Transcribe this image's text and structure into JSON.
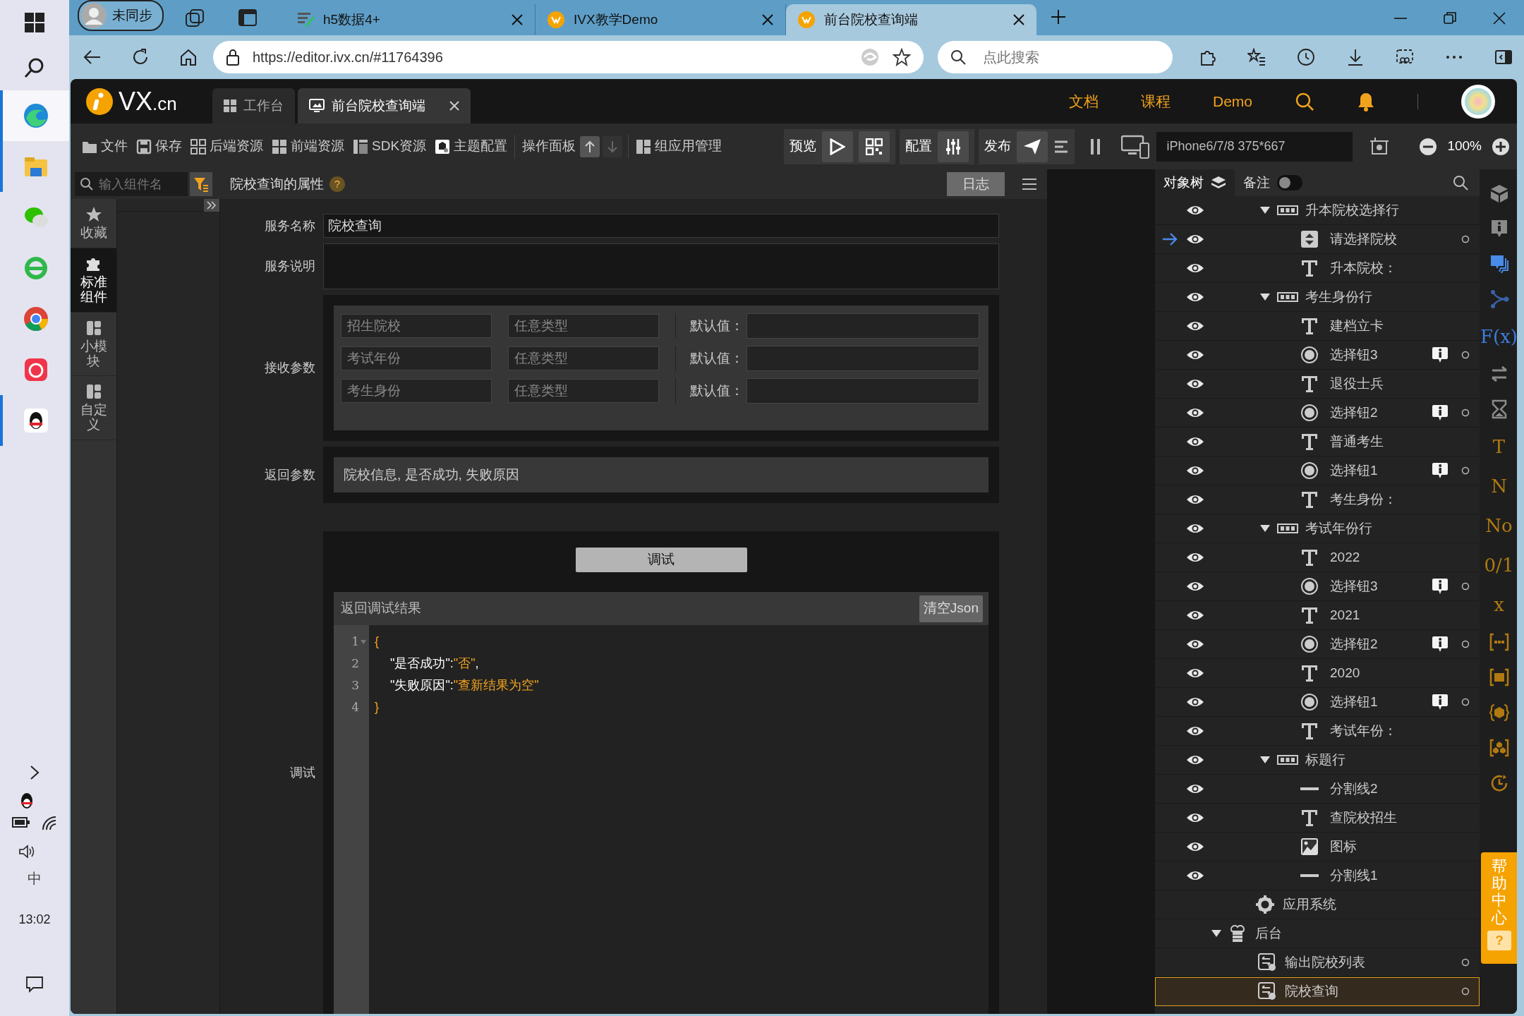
{
  "taskbar": {
    "apps": [
      {
        "running": true,
        "active": true
      },
      {
        "running": true,
        "active": false
      },
      {
        "running": false,
        "active": false
      },
      {
        "running": false,
        "active": false
      },
      {
        "running": false,
        "active": false
      },
      {
        "running": false,
        "active": false
      },
      {
        "running": true,
        "active": false
      }
    ],
    "ime": "中",
    "time": "13:02"
  },
  "browser": {
    "profile": "未同步",
    "tabs": [
      {
        "title": "h5数据4+",
        "selected": false
      },
      {
        "title": "IVX教学Demo",
        "selected": false
      },
      {
        "title": "前台院校查询端",
        "selected": true
      }
    ],
    "url": "https://editor.ivx.cn/#11764396",
    "search_placeholder": "点此搜索"
  },
  "app": {
    "logo": {
      "name": "VX",
      "domain": ".cn"
    },
    "editor_tabs": [
      {
        "label": "工作台",
        "selected": false
      },
      {
        "label": "前台院校查询端",
        "selected": true
      }
    ],
    "header_links": [
      "文档",
      "课程",
      "Demo"
    ],
    "toolbar": {
      "items": [
        "文件",
        "保存",
        "后端资源",
        "前端资源",
        "SDK资源",
        "主题配置"
      ],
      "panel": "操作面板",
      "manage": "组应用管理",
      "preview": "预览",
      "config": "配置",
      "publish": "发布",
      "device": "iPhone6/7/8 375*667",
      "zoom": "100%"
    },
    "component_search": {
      "placeholder": "输入组件名"
    },
    "rail": [
      {
        "label": "收藏",
        "selected": false
      },
      {
        "label": "标准组件",
        "selected": true
      },
      {
        "label": "小模块",
        "selected": false
      },
      {
        "label": "自定义",
        "selected": false
      }
    ],
    "properties": {
      "title": "院校查询的属性",
      "help": "?",
      "log_button": "日志",
      "service_name": {
        "label": "服务名称",
        "value": "院校查询"
      },
      "service_desc": {
        "label": "服务说明"
      },
      "receive": {
        "label": "接收参数",
        "params": [
          {
            "name": "招生院校",
            "type": "任意类型",
            "default_label": "默认值："
          },
          {
            "name": "考试年份",
            "type": "任意类型",
            "default_label": "默认值："
          },
          {
            "name": "考生身份",
            "type": "任意类型",
            "default_label": "默认值："
          }
        ]
      },
      "returns": {
        "label": "返回参数",
        "value": "院校信息, 是否成功, 失败原因"
      },
      "debug": {
        "label": "调试",
        "button": "调试",
        "result_title": "返回调试结果",
        "clear_button": "清空Json",
        "code": [
          {
            "num": "1",
            "fold": true,
            "tokens": [
              {
                "kind": "brace",
                "text": "{"
              }
            ]
          },
          {
            "num": "2",
            "fold": false,
            "tokens": [
              {
                "kind": "key",
                "text": "\"是否成功\""
              },
              {
                "kind": "punct",
                "text": ":"
              },
              {
                "kind": "string",
                "text": "\"否\""
              },
              {
                "kind": "punct",
                "text": ","
              }
            ]
          },
          {
            "num": "3",
            "fold": false,
            "tokens": [
              {
                "kind": "key",
                "text": "\"失败原因\""
              },
              {
                "kind": "punct",
                "text": ":"
              },
              {
                "kind": "string",
                "text": "\"查新结果为空\""
              }
            ]
          },
          {
            "num": "4",
            "fold": false,
            "tokens": [
              {
                "kind": "brace",
                "text": "}"
              }
            ]
          }
        ]
      }
    },
    "tree": {
      "tab": "对象树",
      "notes": {
        "label": "备注",
        "on": false
      },
      "rows": [
        {
          "label": "升本院校选择行",
          "visible": true,
          "expanded": true,
          "children": [
            {
              "label": "请选择院校",
              "kind": "select",
              "visible": true,
              "pointer": true,
              "tip": false,
              "ring": true
            },
            {
              "label": "升本院校：",
              "kind": "text",
              "visible": true,
              "pointer": false,
              "tip": false,
              "ring": false
            }
          ]
        },
        {
          "label": "考生身份行",
          "visible": true,
          "expanded": true,
          "children": [
            {
              "label": "建档立卡",
              "kind": "text",
              "visible": true,
              "pointer": false,
              "tip": false,
              "ring": false
            },
            {
              "label": "选择钮3",
              "kind": "radio",
              "visible": true,
              "pointer": false,
              "tip": true,
              "ring": true
            },
            {
              "label": "退役士兵",
              "kind": "text",
              "visible": true,
              "pointer": false,
              "tip": false,
              "ring": false
            },
            {
              "label": "选择钮2",
              "kind": "radio",
              "visible": true,
              "pointer": false,
              "tip": true,
              "ring": true
            },
            {
              "label": "普通考生",
              "kind": "text",
              "visible": true,
              "pointer": false,
              "tip": false,
              "ring": false
            },
            {
              "label": "选择钮1",
              "kind": "radio",
              "visible": true,
              "pointer": false,
              "tip": true,
              "ring": true
            },
            {
              "label": "考生身份：",
              "kind": "text",
              "visible": true,
              "pointer": false,
              "tip": false,
              "ring": false
            }
          ]
        },
        {
          "label": "考试年份行",
          "visible": true,
          "expanded": true,
          "children": [
            {
              "label": "2022",
              "kind": "text",
              "visible": true,
              "pointer": false,
              "tip": false,
              "ring": false
            },
            {
              "label": "选择钮3",
              "kind": "radio",
              "visible": true,
              "pointer": false,
              "tip": true,
              "ring": true
            },
            {
              "label": "2021",
              "kind": "text",
              "visible": true,
              "pointer": false,
              "tip": false,
              "ring": false
            },
            {
              "label": "选择钮2",
              "kind": "radio",
              "visible": true,
              "pointer": false,
              "tip": true,
              "ring": true
            },
            {
              "label": "2020",
              "kind": "text",
              "visible": true,
              "pointer": false,
              "tip": false,
              "ring": false
            },
            {
              "label": "选择钮1",
              "kind": "radio",
              "visible": true,
              "pointer": false,
              "tip": true,
              "ring": true
            },
            {
              "label": "考试年份：",
              "kind": "text",
              "visible": true,
              "pointer": false,
              "tip": false,
              "ring": false
            }
          ]
        },
        {
          "label": "标题行",
          "visible": true,
          "expanded": true,
          "children": [
            {
              "label": "分割线2",
              "kind": "line",
              "visible": true,
              "pointer": false,
              "tip": false,
              "ring": false
            },
            {
              "label": "查院校招生",
              "kind": "text",
              "visible": true,
              "pointer": false,
              "tip": false,
              "ring": false
            },
            {
              "label": "图标",
              "kind": "image",
              "visible": true,
              "pointer": false,
              "tip": false,
              "ring": false
            },
            {
              "label": "分割线1",
              "kind": "line",
              "visible": true,
              "pointer": false,
              "tip": false,
              "ring": false
            }
          ]
        }
      ],
      "app_system": "应用系统",
      "backend": {
        "label": "后台",
        "expanded": true,
        "children": [
          {
            "label": "输出院校列表",
            "selected": false,
            "ring": true
          },
          {
            "label": "院校查询",
            "selected": true,
            "ring": true
          }
        ]
      }
    },
    "tool_rail": [
      {
        "kind": "icon",
        "color": "#8a8a8a"
      },
      {
        "kind": "icon",
        "color": "#8a8a8a"
      },
      {
        "kind": "icon",
        "color": "#4a8ae8"
      },
      {
        "kind": "icon",
        "color": "#3a62a8"
      },
      {
        "kind": "glyph",
        "text": "F(x)",
        "color": "#3d7de0"
      },
      {
        "kind": "icon",
        "color": "#8a8a8a"
      },
      {
        "kind": "icon",
        "color": "#8a8a8a"
      },
      {
        "kind": "glyph",
        "text": "T",
        "color": "#b07a10"
      },
      {
        "kind": "glyph",
        "text": "N",
        "color": "#b07a10"
      },
      {
        "kind": "glyph",
        "text": "No",
        "color": "#b07a10"
      },
      {
        "kind": "glyph",
        "text": "0/1",
        "color": "#b07a10"
      },
      {
        "kind": "glyph",
        "text": "x",
        "color": "#b07a10"
      },
      {
        "kind": "icon",
        "color": "#b07a10"
      },
      {
        "kind": "icon",
        "color": "#b07a10"
      },
      {
        "kind": "icon",
        "color": "#b07a10"
      },
      {
        "kind": "icon",
        "color": "#b07a10"
      },
      {
        "kind": "icon",
        "color": "#b07a10"
      }
    ],
    "help": {
      "label": "帮助中心",
      "badge": "?"
    }
  }
}
